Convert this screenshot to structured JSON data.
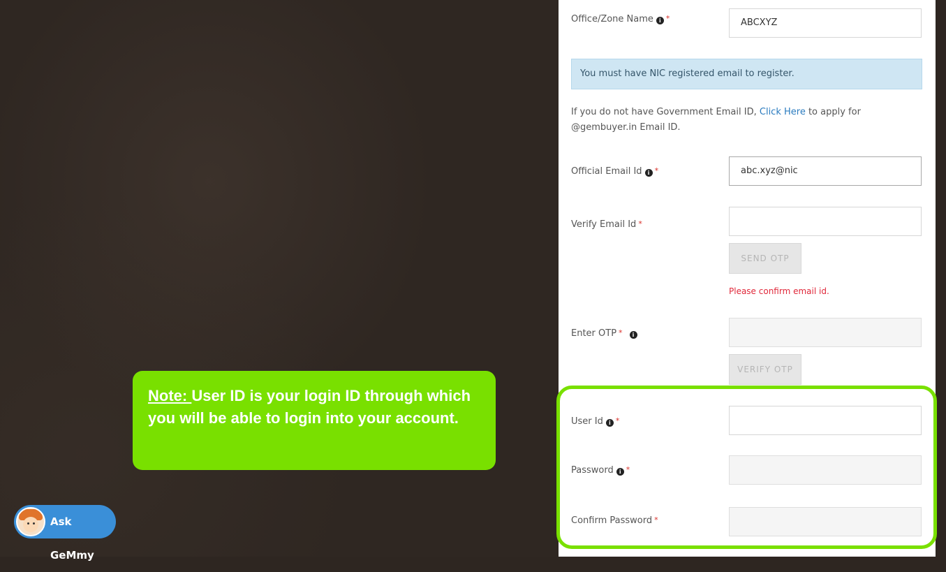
{
  "form": {
    "office_zone": {
      "label": "Office/Zone Name",
      "value": "ABCXYZ"
    },
    "alert": "You must have NIC registered email to register.",
    "gov_email_note": {
      "before": "If you do not have Government Email ID, ",
      "link": "Click Here",
      "after": " to apply for @gembuyer.in Email ID."
    },
    "official_email": {
      "label": "Official Email Id",
      "value": "abc.xyz@nic"
    },
    "verify_email": {
      "label": "Verify Email Id",
      "value": ""
    },
    "send_otp_button": "SEND OTP",
    "email_error": "Please confirm email id.",
    "enter_otp": {
      "label": "Enter OTP",
      "value": ""
    },
    "verify_otp_button": "VERIFY OTP",
    "user_id": {
      "label": "User Id",
      "value": ""
    },
    "password": {
      "label": "Password",
      "value": ""
    },
    "confirm_password": {
      "label": "Confirm Password",
      "value": ""
    },
    "required_marker": "*",
    "info_glyph": "i"
  },
  "note": {
    "prefix": "Note: ",
    "text": "User ID   is your login ID through which you will be able to login into your account."
  },
  "chat_widget": {
    "label": "Ask GeMmy",
    "avatar_icon": "gemmy-avatar-icon"
  },
  "colors": {
    "note_bg": "#79e000",
    "highlight_border": "#79e000",
    "chat_bg": "#3a8fd8",
    "error": "#e0283a",
    "link": "#2a7bbf"
  }
}
